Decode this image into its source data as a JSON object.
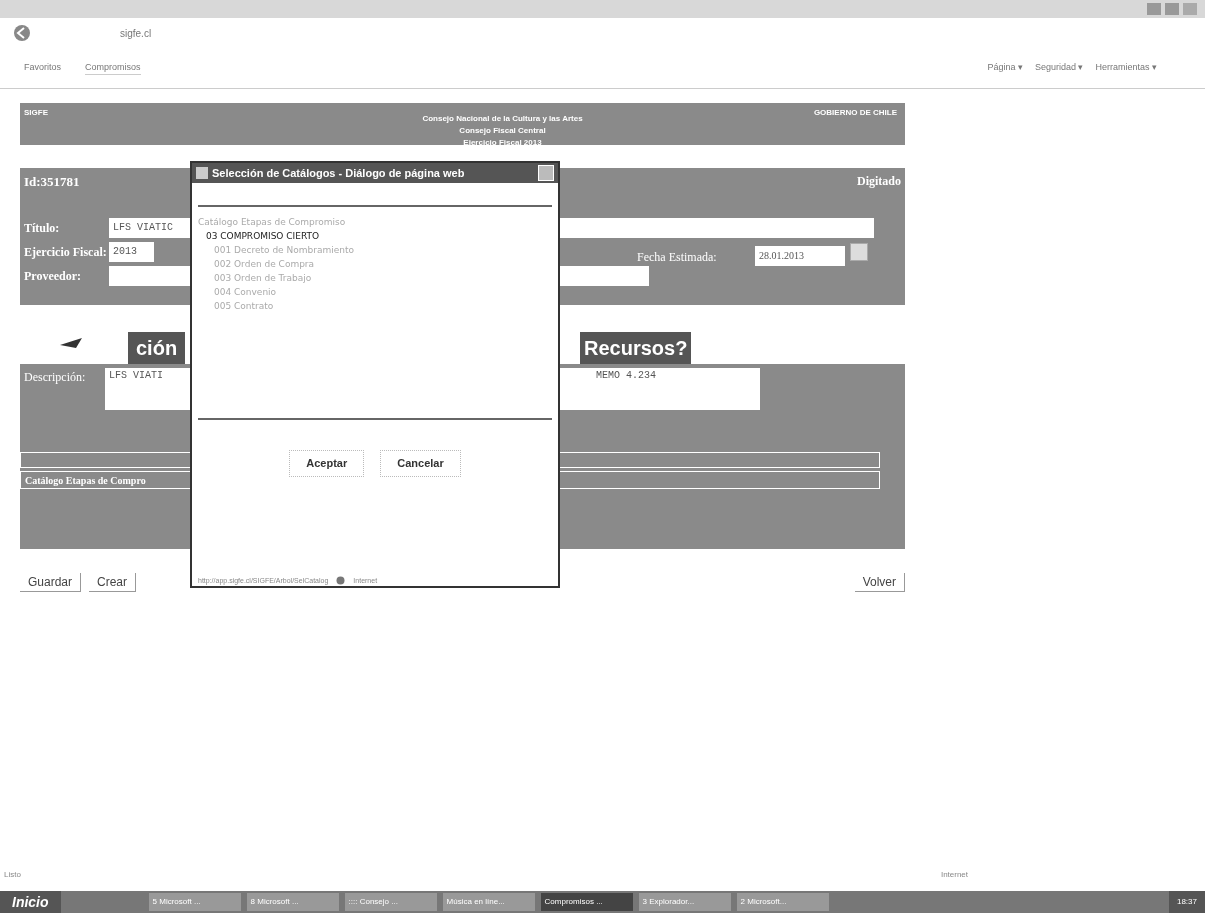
{
  "browser": {
    "address": "sigfe.cl",
    "favorites": "Favoritos",
    "tab": "Compromisos",
    "commands": [
      "Página ▾",
      "Seguridad ▾",
      "Herramientas ▾"
    ]
  },
  "header": {
    "brand": "SIGFE",
    "lines": [
      "Consejo Nacional de la Cultura y las Artes",
      "Consejo Fiscal Central",
      "Ejercicio Fiscal 2013"
    ],
    "government": "GOBIERNO DE CHILE"
  },
  "form": {
    "id": "Id:351781",
    "state": "Digitado",
    "fields": [
      {
        "label": "Título:",
        "value": "LFS VIATIC"
      },
      {
        "label": "Ejercicio Fiscal:",
        "value": "2013"
      },
      {
        "label": "Proveedor:"
      }
    ],
    "date_label": "Fecha Estimada:",
    "date_value": "28.01.2013"
  },
  "banner": {
    "left": "ción",
    "right": "Recursos?"
  },
  "description": {
    "label": "Descripción:",
    "left": "LFS VIATI",
    "right": "MEMO 4.234"
  },
  "catalog_label": "Catálogo Etapas de Compro",
  "buttons": [
    "Guardar",
    "Crear"
  ],
  "back_button": "Volver",
  "dialog": {
    "title": "Selección de Catálogos - Diálogo de página web",
    "tree": [
      {
        "label": "Catálogo Etapas de Compromiso",
        "selected": false,
        "children": [
          {
            "label": "03 COMPROMISO CIERTO",
            "selected": true,
            "children": [
              {
                "label": "001 Decreto de Nombramiento",
                "selected": false
              },
              {
                "label": "002 Orden de Compra",
                "selected": false
              },
              {
                "label": "003 Orden de Trabajo",
                "selected": false
              },
              {
                "label": "004 Convenio",
                "selected": false
              },
              {
                "label": "005 Contrato",
                "selected": false
              }
            ]
          }
        ]
      }
    ],
    "buttons": [
      "Aceptar",
      "Cancelar"
    ],
    "status_url": "http://app.sigfe.cl/SIGFE/Arbol/SelCatalog",
    "zone": "Internet"
  },
  "status_bar": {
    "text": "Listo",
    "zone": "Internet"
  },
  "taskbar": {
    "start": "Inicio",
    "items": [
      {
        "label": "5 Microsoft ...",
        "selected": false
      },
      {
        "label": "8 Microsoft ...",
        "selected": false
      },
      {
        "label": ":::: Consejo ...",
        "selected": false
      },
      {
        "label": "Música en líne...",
        "selected": false
      },
      {
        "label": "Compromisos ...",
        "selected": true
      },
      {
        "label": "3 Explorador...",
        "selected": false
      },
      {
        "label": "2 Microsoft...",
        "selected": false
      }
    ],
    "clock": "18:37"
  }
}
